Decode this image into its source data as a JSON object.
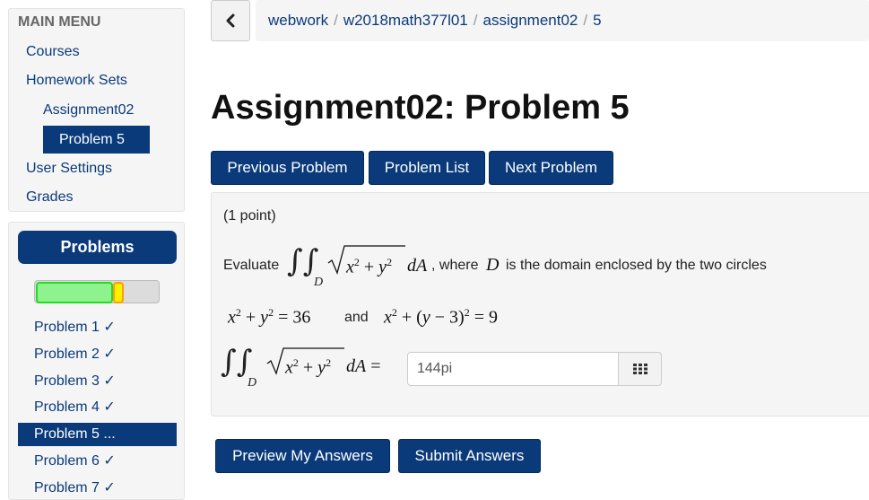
{
  "sidebar": {
    "menu_header": "MAIN MENU",
    "links": {
      "courses": "Courses",
      "homework_sets": "Homework Sets",
      "assignment": "Assignment02",
      "problem": "Problem 5",
      "user_settings": "User Settings",
      "grades": "Grades"
    },
    "problems_header": "Problems",
    "progress": {
      "correct_fraction": 0.64,
      "partial_fraction": 0.09,
      "correct_color": "#8ef28e",
      "partial_color": "#ffef00"
    },
    "problem_items": [
      {
        "label": "Problem 1 ✓"
      },
      {
        "label": "Problem 2 ✓"
      },
      {
        "label": "Problem 3 ✓"
      },
      {
        "label": "Problem 4 ✓"
      },
      {
        "label": "Problem 5 ..."
      },
      {
        "label": "Problem 6 ✓"
      },
      {
        "label": "Problem 7 ✓"
      }
    ],
    "active_problem_index": 4
  },
  "header": {
    "back_icon": "chevron-left-icon",
    "breadcrumb": [
      "webwork",
      "w2018math377l01",
      "assignment02",
      "5"
    ],
    "separator": "/"
  },
  "main": {
    "title": "Assignment02: Problem 5",
    "nav": {
      "previous": "Previous Problem",
      "list": "Problem List",
      "next": "Next Problem"
    },
    "problem": {
      "points": "(1 point)",
      "evaluate": "Evaluate",
      "where_text": ", where",
      "domain_text": "is the domain enclosed by the two circles",
      "domain_symbol": "D",
      "and_text": "and",
      "answer_value": "144pi",
      "grid_icon": "grid-icon"
    },
    "buttons": {
      "preview": "Preview My Answers",
      "submit": "Submit Answers"
    }
  },
  "colors": {
    "accent": "#0a3a7a",
    "panel": "#f5f5f5"
  }
}
